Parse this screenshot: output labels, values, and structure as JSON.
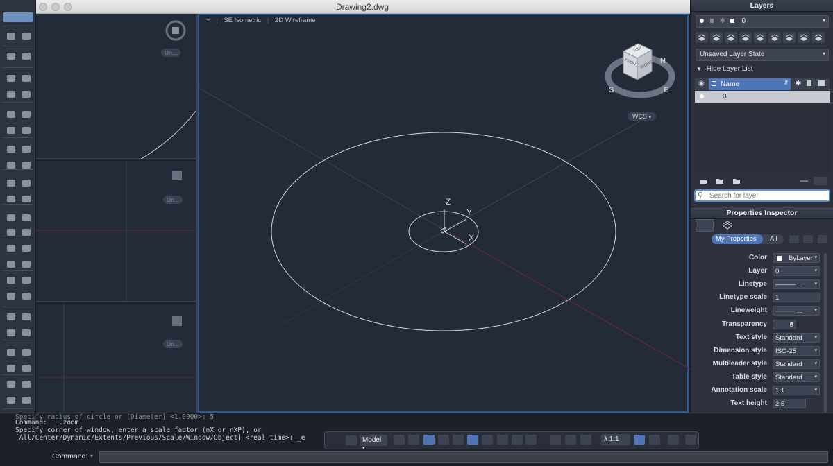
{
  "window": {
    "title": "Drawing2.dwg"
  },
  "viewport": {
    "label_plus": "+",
    "view_name": "SE Isometric",
    "visual_style": "2D Wireframe",
    "wcs_label": "WCS",
    "unnamed_label": "Un..."
  },
  "viewcube": {
    "top": "TOP",
    "front": "FRONT",
    "right": "RIGHT",
    "compass_n": "N",
    "compass_s": "S",
    "compass_e": "E"
  },
  "ucs": {
    "x": "X",
    "y": "Y",
    "z": "Z"
  },
  "layers": {
    "title": "Layers",
    "current_layer": "0",
    "layer_state": "Unsaved Layer State",
    "hide_list_label": "Hide Layer List",
    "column_name": "Name",
    "rows": [
      {
        "name": "0"
      }
    ],
    "search_placeholder": "Search for layer"
  },
  "properties": {
    "title": "Properties Inspector",
    "tab_my": "My Properties",
    "tab_all": "All",
    "rows": [
      {
        "label": "Color",
        "value": "ByLayer"
      },
      {
        "label": "Layer",
        "value": "0"
      },
      {
        "label": "Linetype",
        "value": "——— ..."
      },
      {
        "label": "Linetype scale",
        "value": "1"
      },
      {
        "label": "Lineweight",
        "value": "——— ..."
      },
      {
        "label": "Transparency",
        "value": "0"
      },
      {
        "label": "Text style",
        "value": "Standard"
      },
      {
        "label": "Dimension style",
        "value": "ISO-25"
      },
      {
        "label": "Multileader style",
        "value": "Standard"
      },
      {
        "label": "Table style",
        "value": "Standard"
      },
      {
        "label": "Annotation scale",
        "value": "1:1"
      },
      {
        "label": "Text height",
        "value": "2.5"
      }
    ]
  },
  "command": {
    "history": [
      "Specify radius of circle or [Diameter] <1.0000>: 5",
      "Command: '_.zoom",
      "Specify corner of window, enter a scale factor (nX or nXP), or",
      "[All/Center/Dynamic/Extents/Previous/Scale/Window/Object] <real time>: _e"
    ],
    "label": "Command:"
  },
  "statusbar": {
    "model_label": "Model",
    "scale_label": "1:1"
  },
  "colors": {
    "accent": "#2d5a9c",
    "viewport_bg": "#232a38",
    "panel_bg": "#2c313d"
  }
}
